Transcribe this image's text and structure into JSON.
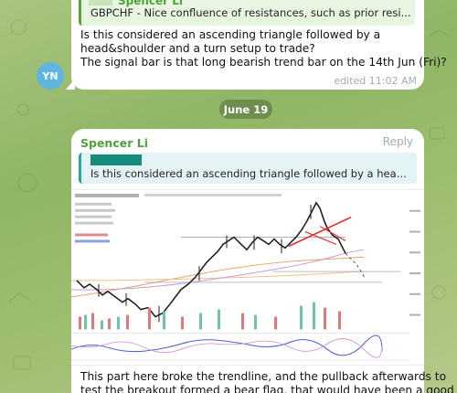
{
  "message_prev": {
    "reply_author": "Spencer Li",
    "reply_text": "GBPCHF - Nice confluence of resistances, such as prior resi...",
    "body_lines": [
      "Is this considered an ascending triangle followed by a",
      "head&shoulder and a turn setup to trade?",
      "The signal bar is that long bearish trend bar on the 14th Jun (Fri)?"
    ],
    "edited": "edited 11:02 AM",
    "avatar_initials": "YN",
    "avatar_color": "#5fb5e0"
  },
  "date_separator": "June 19",
  "message_current": {
    "author": "Spencer Li",
    "reply_label": "Reply",
    "quote_text": "Is this considered an ascending triangle followed by a head&sho...",
    "body_lines": [
      "This part here broke the trendline, and the pullback afterwards to",
      "test the breakout formed a bear flag, that would have been a good"
    ]
  },
  "colors": {
    "author_green": "#4fa13b",
    "quote_bar": "#2aa8a0",
    "bubble": "#ffffff"
  }
}
